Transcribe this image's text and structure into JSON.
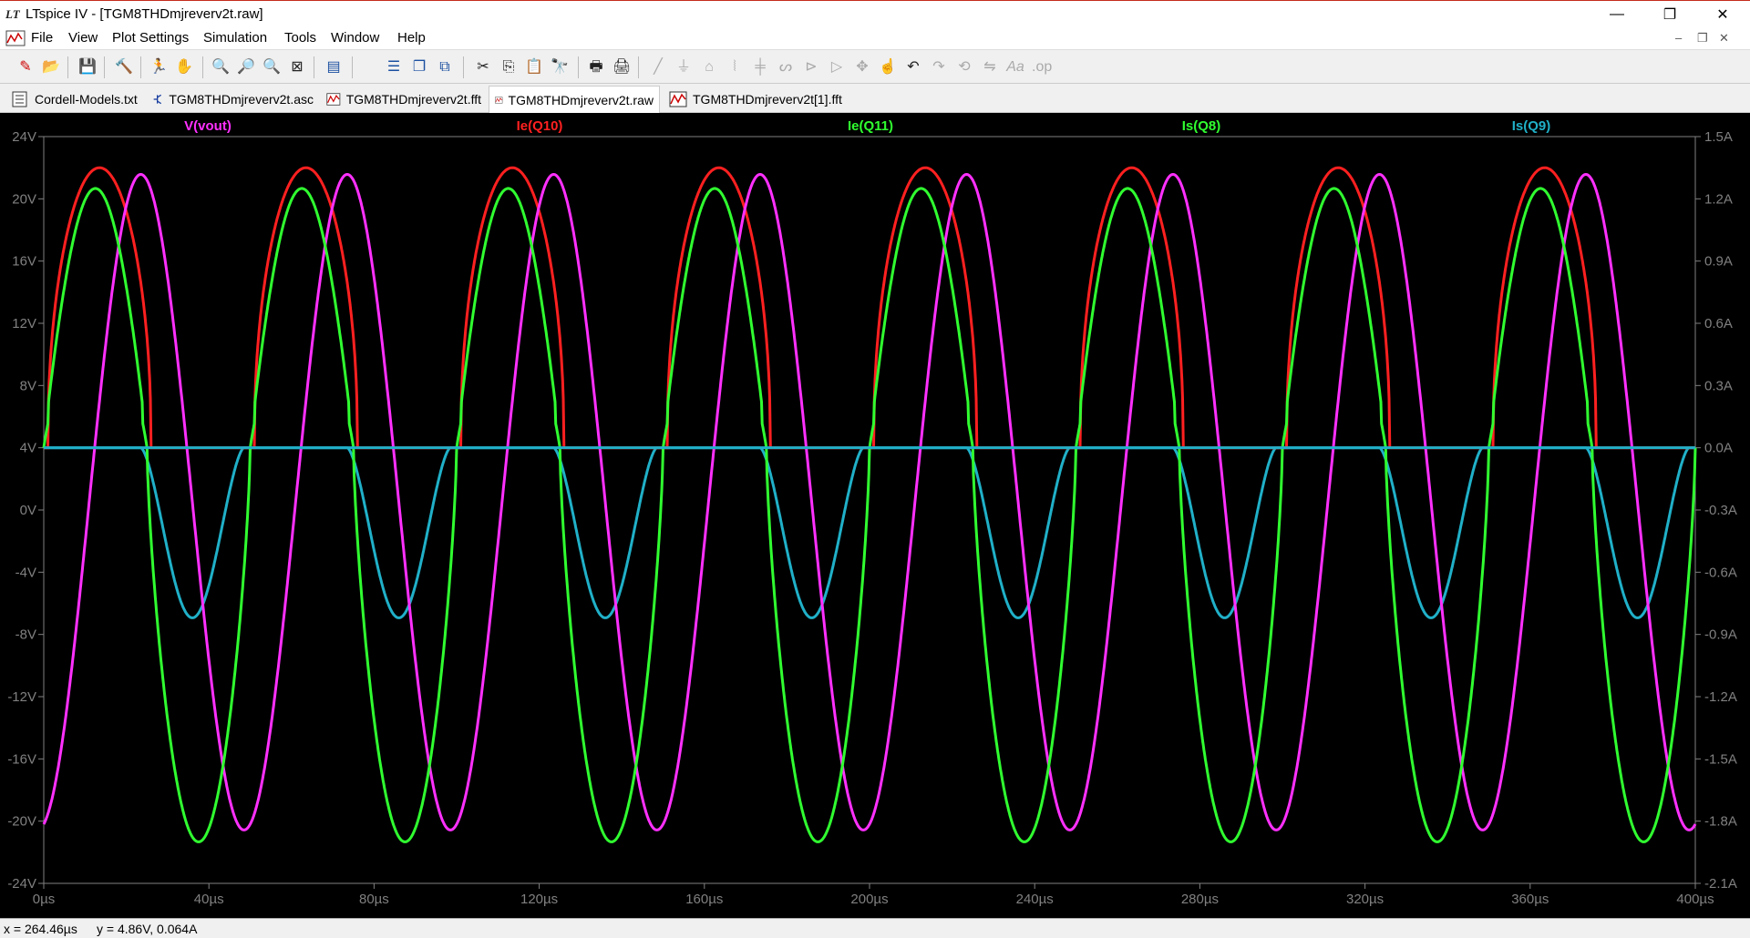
{
  "window": {
    "title": "LTspice IV - [TGM8THDmjreverv2t.raw]",
    "minimize": "—",
    "restore": "❐",
    "close": "✕"
  },
  "menu": {
    "items": [
      "File",
      "View",
      "Plot Settings",
      "Simulation",
      "Tools",
      "Window",
      "Help"
    ],
    "mdi_controls": [
      "‒",
      "❐",
      "✕"
    ]
  },
  "tabs": [
    {
      "label": "Cordell-Models.txt",
      "icon": "text-file-icon"
    },
    {
      "label": "TGM8THDmjreverv2t.asc",
      "icon": "schematic-icon"
    },
    {
      "label": "TGM8THDmjreverv2t.fft",
      "icon": "waveform-icon"
    },
    {
      "label": "TGM8THDmjreverv2t.raw",
      "icon": "waveform-icon",
      "active": true
    },
    {
      "label": "TGM8THDmjreverv2t[1].fft",
      "icon": "waveform-icon"
    }
  ],
  "status": {
    "x": "x = 264.46µs",
    "y": "y = 4.86V, 0.064A"
  },
  "colors": {
    "vout": "#ff30ff",
    "ie_q10": "#ff2020",
    "ie_q11": "#30ff30",
    "is_q8": "#30ff30",
    "is_q9": "#20b0c8",
    "axis": "#808080"
  },
  "chart_data": {
    "type": "line",
    "x_unit": "µs",
    "xlim": [
      0,
      400
    ],
    "ylim_left": [
      -24,
      24
    ],
    "ylim_right": [
      -2.1,
      1.5
    ],
    "x_ticks": [
      "0µs",
      "40µs",
      "80µs",
      "120µs",
      "160µs",
      "200µs",
      "240µs",
      "280µs",
      "320µs",
      "360µs",
      "400µs"
    ],
    "y_ticks_left": [
      "24V",
      "20V",
      "16V",
      "12V",
      "8V",
      "4V",
      "0V",
      "-4V",
      "-8V",
      "-12V",
      "-16V",
      "-20V",
      "-24V"
    ],
    "y_ticks_right": [
      "1.5A",
      "1.2A",
      "0.9A",
      "0.6A",
      "0.3A",
      "0.0A",
      "-0.3A",
      "-0.6A",
      "-0.9A",
      "-1.2A",
      "-1.5A",
      "-1.8A",
      "-2.1A"
    ],
    "period_us": 50,
    "series": [
      {
        "name": "V(vout)",
        "axis": "left",
        "amplitude_V": 21.5,
        "peak_V": 21.5,
        "trough_V": -21.5
      },
      {
        "name": "Ie(Q10)",
        "axis": "right",
        "peak_A": 1.35,
        "conduction": "positive half-cycle (flattened top)"
      },
      {
        "name": "Ie(Q11)",
        "axis": "right",
        "peak_A": 1.25,
        "trough_A": -1.9
      },
      {
        "name": "Is(Q8)",
        "axis": "right",
        "peak_A": 1.25,
        "trough_A": -1.9
      },
      {
        "name": "Is(Q9)",
        "axis": "right",
        "trough_A": -0.82,
        "conduction": "negative half-cycle"
      }
    ],
    "grid": false,
    "legend": "top"
  }
}
